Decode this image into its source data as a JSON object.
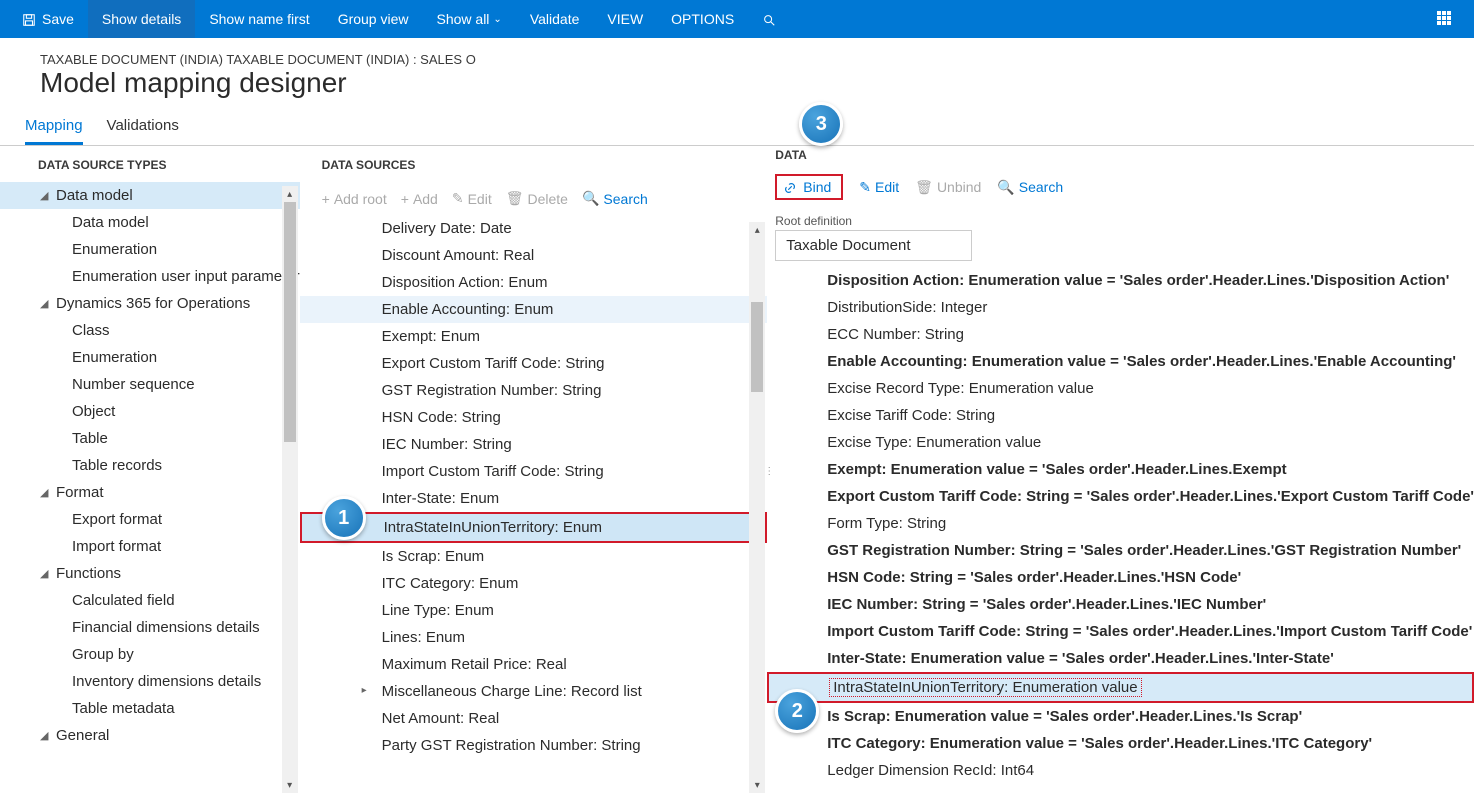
{
  "ribbon": {
    "save": "Save",
    "show_details": "Show details",
    "show_name_first": "Show name first",
    "group_view": "Group view",
    "show_all": "Show all",
    "validate": "Validate",
    "view": "VIEW",
    "options": "OPTIONS"
  },
  "breadcrumb": "TAXABLE DOCUMENT (INDIA) TAXABLE DOCUMENT (INDIA) : SALES O",
  "page_title": "Model mapping designer",
  "tabs": {
    "mapping": "Mapping",
    "validations": "Validations"
  },
  "types": {
    "header": "DATA SOURCE TYPES",
    "items": [
      "Data model",
      "Data model",
      "Enumeration",
      "Enumeration user input parameter",
      "Dynamics 365 for Operations",
      "Class",
      "Enumeration",
      "Number sequence",
      "Object",
      "Table",
      "Table records",
      "Format",
      "Export format",
      "Import format",
      "Functions",
      "Calculated field",
      "Financial dimensions details",
      "Group by",
      "Inventory dimensions details",
      "Table metadata",
      "General"
    ]
  },
  "sources": {
    "header": "DATA SOURCES",
    "toolbar": {
      "add_root": "Add root",
      "add": "Add",
      "edit": "Edit",
      "delete": "Delete",
      "search": "Search"
    },
    "items": [
      "Delivery Date: Date",
      "Discount Amount: Real",
      "Disposition Action: Enum",
      "Enable Accounting: Enum",
      "Exempt: Enum",
      "Export Custom Tariff Code: String",
      "GST Registration Number: String",
      "HSN Code: String",
      "IEC Number: String",
      "Import Custom Tariff Code: String",
      "Inter-State: Enum",
      "IntraStateInUnionTerritory: Enum",
      "Is Scrap: Enum",
      "ITC Category: Enum",
      "Line Type: Enum",
      "Lines: Enum",
      "Maximum Retail Price: Real",
      "Miscellaneous Charge Line: Record list",
      "Net Amount: Real",
      "Party GST Registration Number: String"
    ]
  },
  "model": {
    "header": "DATA",
    "toolbar": {
      "bind": "Bind",
      "edit": "Edit",
      "unbind": "Unbind",
      "search": "Search"
    },
    "root_label": "Root definition",
    "root_value": "Taxable Document",
    "items": [
      {
        "text": "Disposition Action: Enumeration value = 'Sales order'.Header.Lines.'Disposition Action'",
        "bold": true
      },
      {
        "text": "DistributionSide: Integer",
        "bold": false
      },
      {
        "text": "ECC Number: String",
        "bold": false
      },
      {
        "text": "Enable Accounting: Enumeration value = 'Sales order'.Header.Lines.'Enable Accounting'",
        "bold": true
      },
      {
        "text": "Excise Record Type: Enumeration value",
        "bold": false
      },
      {
        "text": "Excise Tariff Code: String",
        "bold": false
      },
      {
        "text": "Excise Type: Enumeration value",
        "bold": false
      },
      {
        "text": "Exempt: Enumeration value = 'Sales order'.Header.Lines.Exempt",
        "bold": true
      },
      {
        "text": "Export Custom Tariff Code: String = 'Sales order'.Header.Lines.'Export Custom Tariff Code'",
        "bold": true
      },
      {
        "text": "Form Type: String",
        "bold": false
      },
      {
        "text": "GST Registration Number: String = 'Sales order'.Header.Lines.'GST Registration Number'",
        "bold": true
      },
      {
        "text": "HSN Code: String = 'Sales order'.Header.Lines.'HSN Code'",
        "bold": true
      },
      {
        "text": "IEC Number: String = 'Sales order'.Header.Lines.'IEC Number'",
        "bold": true
      },
      {
        "text": "Import Custom Tariff Code: String = 'Sales order'.Header.Lines.'Import Custom Tariff Code'",
        "bold": true
      },
      {
        "text": "Inter-State: Enumeration value = 'Sales order'.Header.Lines.'Inter-State'",
        "bold": true
      },
      {
        "text": "IntraStateInUnionTerritory: Enumeration value",
        "bold": false,
        "selected": true,
        "boxed": true
      },
      {
        "text": "Is Scrap: Enumeration value = 'Sales order'.Header.Lines.'Is Scrap'",
        "bold": true
      },
      {
        "text": "ITC Category: Enumeration value = 'Sales order'.Header.Lines.'ITC Category'",
        "bold": true
      },
      {
        "text": "Ledger Dimension RecId: Int64",
        "bold": false
      }
    ]
  },
  "callouts": {
    "one": "1",
    "two": "2",
    "three": "3"
  }
}
